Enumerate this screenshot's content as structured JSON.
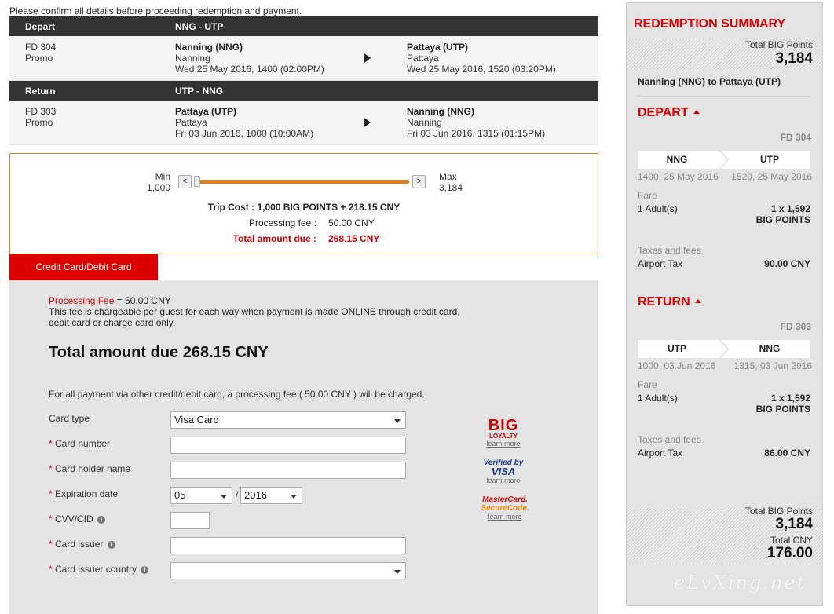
{
  "intro": "Please confirm all details before proceeding redemption and payment.",
  "flights": [
    {
      "label": "Depart",
      "route": "NNG - UTP",
      "flight_no": "FD 304",
      "fare_type": "Promo",
      "from_code": "Nanning (NNG)",
      "from_city": "Nanning",
      "from_time": "Wed 25 May 2016, 1400 (02:00PM)",
      "to_code": "Pattaya (UTP)",
      "to_city": "Pattaya",
      "to_time": "Wed 25 May 2016, 1520 (03:20PM)"
    },
    {
      "label": "Return",
      "route": "UTP - NNG",
      "flight_no": "FD 303",
      "fare_type": "Promo",
      "from_code": "Pattaya (UTP)",
      "from_city": "Pattaya",
      "from_time": "Fri 03 Jun 2016, 1000 (10:00AM)",
      "to_code": "Nanning (NNG)",
      "to_city": "Nanning",
      "to_time": "Fri 03 Jun 2016, 1315 (01:15PM)"
    }
  ],
  "slider": {
    "min_label": "Min",
    "min_value": "1,000",
    "max_label": "Max",
    "max_value": "3,184",
    "left_btn": "<",
    "right_btn": ">",
    "position_fraction": 0,
    "trip_cost": "Trip Cost : 1,000 BIG POINTS + 218.15 CNY",
    "processing_fee_label": "Processing fee :",
    "processing_fee_value": "50.00 CNY",
    "total_due_label": "Total amount due :",
    "total_due_value": "268.15 CNY"
  },
  "payment": {
    "tab_label": "Credit Card/Debit Card",
    "fee_title": "Processing Fee",
    "fee_amount": " = 50.00 CNY",
    "fee_desc_1": "This fee is chargeable per guest for each way when payment is made ONLINE through credit card,",
    "fee_desc_2": "debit card or charge card only.",
    "total": "Total amount due 268.15 CNY",
    "note": "For all payment via other credit/debit card, a processing fee ( 50.00 CNY ) will be charged.",
    "fields": {
      "card_type_label": "Card type",
      "card_type_value": "Visa Card",
      "card_number_label": "Card number",
      "card_holder_label": "Card holder name",
      "expiry_label": "Expiration date",
      "expiry_month": "05",
      "expiry_sep": "/",
      "expiry_year": "2016",
      "cvv_label": "CVV/CID",
      "issuer_label": "Card issuer",
      "issuer_country_label": "Card issuer country",
      "required_mark": "*",
      "info_glyph": "i"
    },
    "logos": {
      "big_t1": "BIG",
      "big_t2": "LOYALTY",
      "visa_t1": "Verified by",
      "visa_t2": "VISA",
      "mc_t1": "MasterCard.",
      "mc_t2": "SecureCode.",
      "learn_more": "learn more"
    }
  },
  "summary": {
    "title": "REDEMPTION SUMMARY",
    "total_big_points_label": "Total BIG Points",
    "total_big_points": "3,184",
    "route_text": "Nanning (NNG) to Pattaya (UTP)",
    "depart": {
      "title": "DEPART",
      "flight": "FD 304",
      "from": "NNG",
      "to": "UTP",
      "from_time": "1400, 25 May 2016",
      "to_time": "1520, 25 May 2016",
      "fare_label": "Fare",
      "adult_label": "1 Adult(s)",
      "adult_value_1": "1 x 1,592",
      "adult_value_2": "BIG POINTS",
      "taxes_label": "Taxes and fees",
      "airport_tax_label": "Airport Tax",
      "airport_tax_value": "90.00 CNY"
    },
    "return": {
      "title": "RETURN",
      "flight": "FD 303",
      "from": "UTP",
      "to": "NNG",
      "from_time": "1000, 03 Jun 2016",
      "to_time": "1315, 03 Jun 2016",
      "fare_label": "Fare",
      "adult_label": "1 Adult(s)",
      "adult_value_1": "1 x 1,592",
      "adult_value_2": "BIG POINTS",
      "taxes_label": "Taxes and fees",
      "airport_tax_label": "Airport Tax",
      "airport_tax_value": "86.00 CNY"
    },
    "footer_points_label": "Total BIG Points",
    "footer_points": "3,184",
    "footer_cny_label": "Total CNY",
    "footer_cny": "176.00"
  },
  "watermark": "eLvXing.net",
  "colors": {
    "brand_red": "#dd0000",
    "accent_orange": "#d9822b",
    "header_dark": "#333333"
  }
}
